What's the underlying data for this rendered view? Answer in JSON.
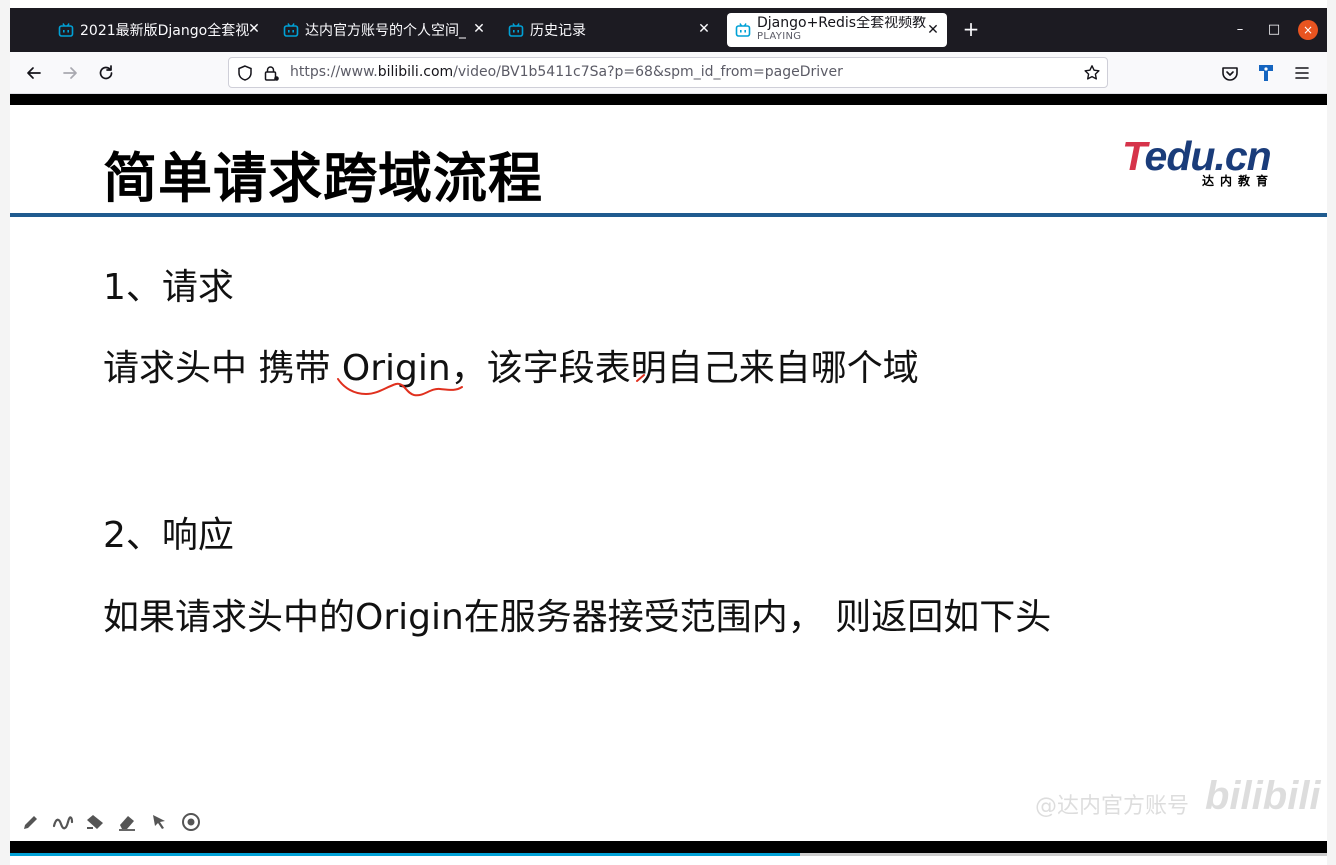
{
  "browser": {
    "tabs": [
      {
        "title": "2021最新版Django全套视",
        "active": false
      },
      {
        "title": "达内官方账号的个人空间_",
        "active": false
      },
      {
        "title": "历史记录",
        "active": false
      },
      {
        "title": "Django+Redis全套视频教",
        "subtitle": "PLAYING",
        "active": true
      }
    ],
    "new_tab_label": "+",
    "url_prefix": "https://www.",
    "url_host": "bilibili.com",
    "url_path": "/video/BV1b5411c7Sa?p=68&spm_id_from=pageDriver",
    "window_controls": [
      "–",
      "□",
      "×"
    ],
    "accent_color": "#e95420",
    "tab_icon_color": "#00a1d6"
  },
  "slide": {
    "title": "简单请求跨域流程",
    "logo_word_t": "T",
    "logo_word_rest": "edu.cn",
    "logo_sub": "达内教育",
    "lines": [
      "1、请求",
      "请求头中 携带 Origin，该字段表明自己来自哪个域",
      "2、响应",
      "如果请求头中的Origin在服务器接受范围内， 则返回如下头"
    ],
    "rule_color": "#1f5b8f",
    "ink_color": "#e0301e"
  },
  "player": {
    "tools": [
      "pen-icon",
      "curve-icon",
      "highlighter-icon",
      "eraser-icon",
      "pointer-icon",
      "record-icon"
    ],
    "watermark_text": "@达内官方账号",
    "watermark_logo": "bilibili",
    "progress": 0.6
  }
}
